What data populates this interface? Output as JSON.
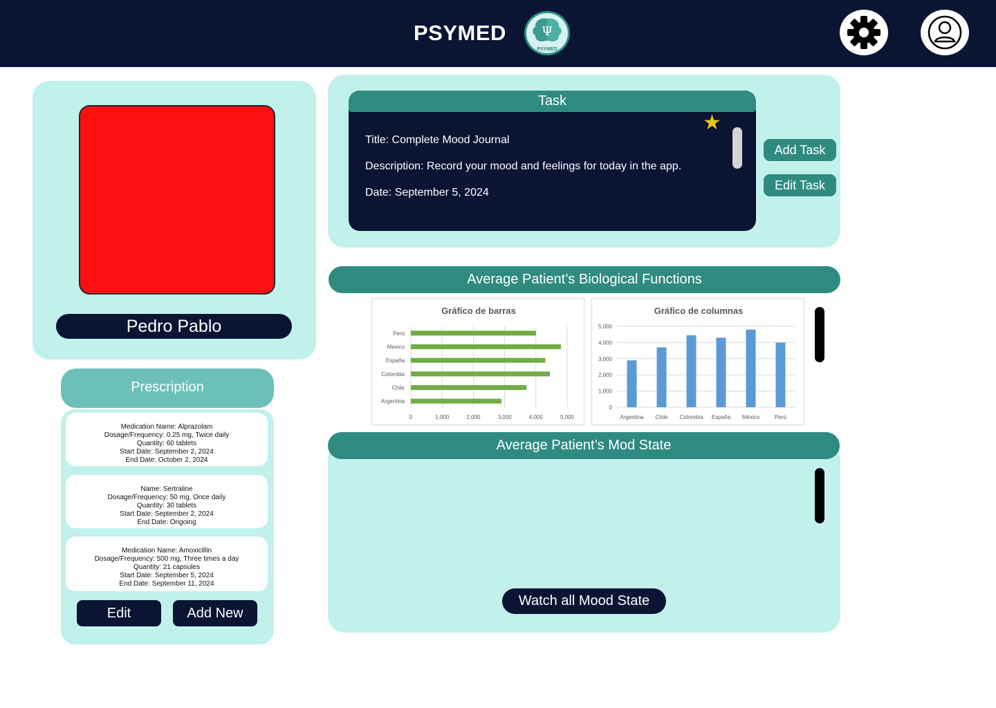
{
  "header": {
    "brand": "PSYMED",
    "logo_text": "PSYMED",
    "logo_glyph": "Ψ",
    "icons": [
      "brain-logo-icon",
      "gear-icon",
      "user-avatar-icon"
    ]
  },
  "patient": {
    "name": "Pedro Pablo"
  },
  "prescription": {
    "title": "Prescription",
    "items": [
      {
        "line1": "Medication Name: Alprazolam",
        "line2": "Dosage/Frequency: 0.25 mg, Twice daily",
        "line3": "Quantity: 60 tablets",
        "line4": "Start Date: September 2, 2024",
        "line5": "End Date: October 2, 2024"
      },
      {
        "line1": "Name: Sertraline",
        "line2": "Dosage/Frequency: 50 mg, Once daily",
        "line3": "Quantity: 30 tablets",
        "line4": "Start Date: September 2, 2024",
        "line5": "End Date: Ongoing"
      },
      {
        "line1": "Medication Name: Amoxicillin",
        "line2": "Dosage/Frequency: 500 mg, Three times a day",
        "line3": "Quantity: 21 capsules",
        "line4": "Start Date: September 5, 2024",
        "line5": "End Date: September 11, 2024"
      }
    ],
    "edit_label": "Edit",
    "add_label": "Add New"
  },
  "task": {
    "header": "Task",
    "title": "Title: Complete Mood Journal",
    "description": "Description: Record your mood and feelings for today in the app.",
    "date": "Date: September 5, 2024",
    "star_glyph": "★",
    "add_label": "Add Task",
    "edit_label": "Edit Task"
  },
  "bio": {
    "title": "Average Patient’s Biological Functions"
  },
  "mood": {
    "title": "Average Patient’s Mod State",
    "watch_label": "Watch all Mood State"
  },
  "colors": {
    "navy": "#0b1433",
    "teal": "#2f8b80",
    "mint": "#c2f1ec",
    "bar_green": "#70ad47",
    "column_blue": "#5b9bd5",
    "star": "#e8c515",
    "photo_red": "#ff1010"
  },
  "chart_data": [
    {
      "type": "bar",
      "title": "Gráfico de barras",
      "categories": [
        "Perú",
        "México",
        "España",
        "Colombia",
        "Chile",
        "Argentina"
      ],
      "values": [
        4000,
        4800,
        4300,
        4450,
        3700,
        2900
      ],
      "xlim": [
        0,
        5000
      ],
      "ticks": [
        "0",
        "1,000",
        "2,000",
        "3,000",
        "4,000",
        "5,000"
      ],
      "grid": true
    },
    {
      "type": "bar",
      "title": "Gráfico de columnas",
      "categories": [
        "Argentina",
        "Chile",
        "Colombia",
        "España",
        "México",
        "Perú"
      ],
      "values": [
        2900,
        3700,
        4450,
        4300,
        4800,
        4000
      ],
      "ylim": [
        0,
        5000
      ],
      "ticks": [
        "0",
        "1,000",
        "2,000",
        "3,000",
        "4,000",
        "5,000"
      ],
      "grid": true
    }
  ]
}
